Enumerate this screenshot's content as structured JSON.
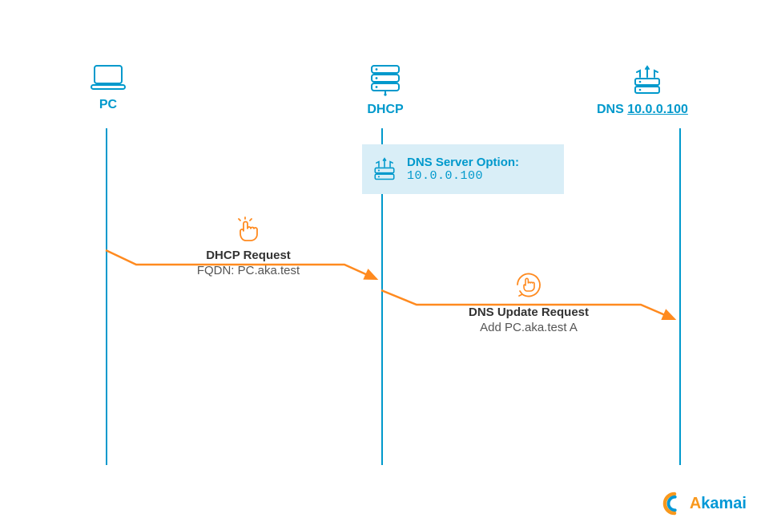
{
  "nodes": {
    "pc": {
      "label": "PC"
    },
    "dhcp": {
      "label": "DHCP"
    },
    "dns": {
      "label_prefix": "DNS ",
      "ip": "10.0.0.100"
    }
  },
  "dns_option": {
    "title": "DNS Server Option:",
    "ip": "10.0.0.100"
  },
  "messages": [
    {
      "title": "DHCP Request",
      "sub": "FQDN: PC.aka.test"
    },
    {
      "title": "DNS Update Request",
      "sub": "Add PC.aka.test A"
    }
  ],
  "brand": {
    "first": "A",
    "rest": "kamai"
  },
  "colors": {
    "blue": "#0099cc",
    "orange": "#ff8a1f",
    "akamai_orange": "#f8981d",
    "akamai_blue": "#0098d6"
  },
  "chart_data": {
    "type": "table",
    "diagram": "sequence",
    "participants": [
      "PC",
      "DHCP",
      "DNS 10.0.0.100"
    ],
    "annotations": [
      {
        "on": "DHCP",
        "text": "DNS Server Option: 10.0.0.100"
      }
    ],
    "messages": [
      {
        "from": "PC",
        "to": "DHCP",
        "label": "DHCP Request",
        "detail": "FQDN: PC.aka.test"
      },
      {
        "from": "DHCP",
        "to": "DNS",
        "label": "DNS Update Request",
        "detail": "Add PC.aka.test A"
      }
    ]
  }
}
